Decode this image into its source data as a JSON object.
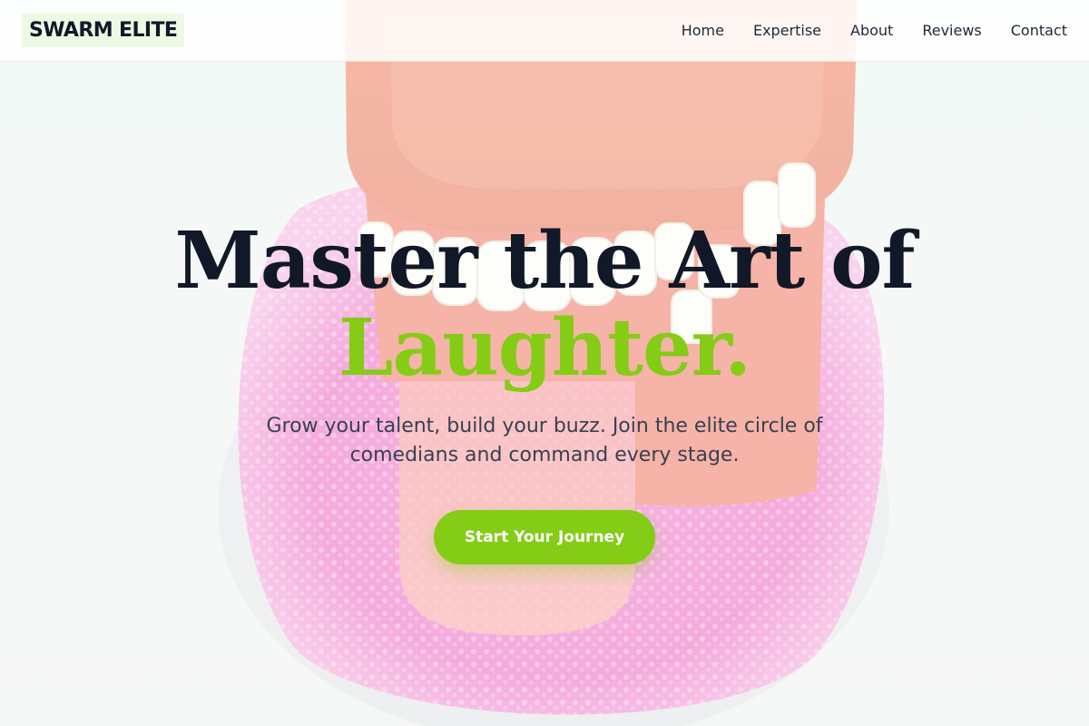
{
  "brand": {
    "logo_text": "SWARM ELITE"
  },
  "nav": {
    "items": [
      {
        "label": "Home"
      },
      {
        "label": "Expertise"
      },
      {
        "label": "About"
      },
      {
        "label": "Reviews"
      },
      {
        "label": "Contact"
      }
    ]
  },
  "hero": {
    "headline_line1": "Master the Art of",
    "headline_line2": "Laughter.",
    "subtitle": "Grow your talent, build your buzz. Join the elite circle of comedians and command every stage.",
    "cta_label": "Start Your Journey",
    "background_image": "wind-up-chattering-teeth-on-pink-sponge"
  },
  "colors": {
    "accent": "#84cc16",
    "headline": "#111827",
    "body_text": "#374151",
    "logo_bg": "#eef8e3"
  }
}
